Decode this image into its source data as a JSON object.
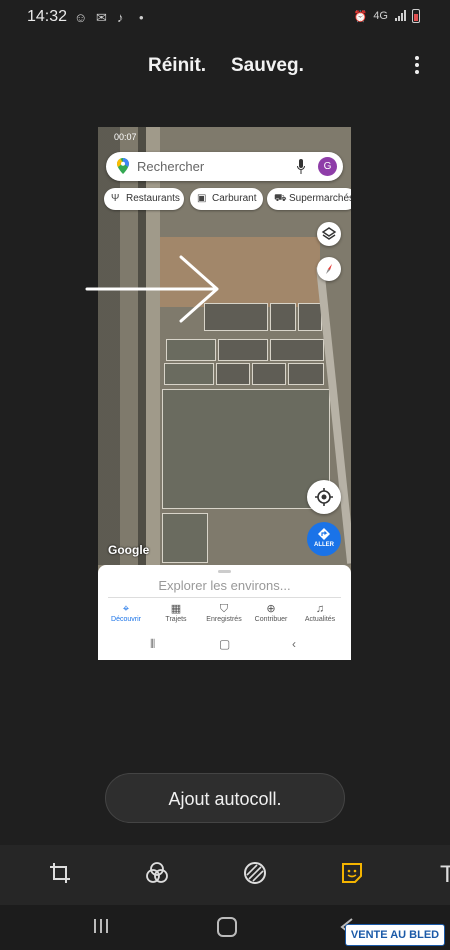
{
  "status_bar": {
    "time": "14:32",
    "network": "4G",
    "icons": [
      "snapchat-icon",
      "messenger-icon",
      "tiktok-icon",
      "dot-icon",
      "alarm-icon",
      "signal-icon",
      "battery-icon"
    ]
  },
  "editor": {
    "reset_label": "Réinit.",
    "save_label": "Sauveg.",
    "sticker_button_label": "Ajout autocoll.",
    "tools": [
      "crop-rotate-icon",
      "filter-icon",
      "draw-icon",
      "sticker-icon",
      "text-icon"
    ],
    "active_tool": "sticker-icon",
    "active_color": "#f4b400",
    "text_tool_glyph": "T"
  },
  "screenshot": {
    "mini_status": {
      "time": "00:07"
    },
    "search": {
      "placeholder": "Rechercher",
      "avatar_letter": "G"
    },
    "chips": [
      {
        "label": "Restaurants",
        "icon": "fork-knife-icon"
      },
      {
        "label": "Carburant",
        "icon": "fuel-pump-icon"
      },
      {
        "label": "Supermarchés",
        "icon": "cart-icon"
      }
    ],
    "aller_label": "ALLER",
    "google_label": "Google",
    "explore_label": "Explorer les environs...",
    "tabs": [
      {
        "label": "Découvrir",
        "active": true
      },
      {
        "label": "Trajets",
        "active": false
      },
      {
        "label": "Enregistrés",
        "active": false
      },
      {
        "label": "Contribuer",
        "active": false
      },
      {
        "label": "Actualités",
        "active": false
      }
    ],
    "accent_color": "#1a73e8"
  },
  "watermark": "VENTE AU BLED"
}
